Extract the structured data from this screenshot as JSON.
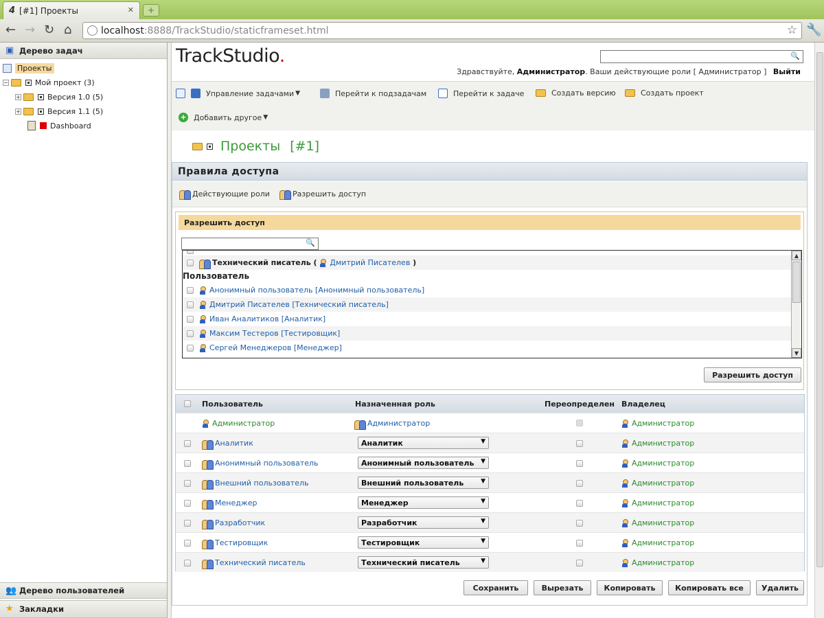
{
  "browser": {
    "tab_title": "[#1] Проекты",
    "url_host": "localhost",
    "url_rest": ":8888/TrackStudio/staticframeset.html"
  },
  "left": {
    "tasks_header": "Дерево задач",
    "tree": [
      {
        "label": "Проекты"
      },
      {
        "label": "Мой проект (3)"
      },
      {
        "label": "Версия 1.0 (5)"
      },
      {
        "label": "Версия 1.1 (5)"
      },
      {
        "label": "Dashboard"
      }
    ],
    "users_header": "Дерево пользователей",
    "bookmarks_header": "Закладки"
  },
  "header": {
    "logo": "TrackStudio",
    "logo_dot": ".",
    "greeting_pre": "Здравствуйте, ",
    "user": "Администратор",
    "greeting_mid": ". Ваши действующие роли  [ Администратор ]",
    "logout": "Выйти"
  },
  "toolbar": {
    "manage_tasks": "Управление задачами",
    "goto_subtasks": "Перейти к подзадачам",
    "goto_task": "Перейти к задаче",
    "create_version": "Создать версию",
    "create_project": "Создать проект",
    "add_other": "Добавить другое"
  },
  "page": {
    "title": "Проекты",
    "number": "[#1]"
  },
  "access": {
    "header": "Правила доступа",
    "effective_roles": "Действующие роли",
    "grant_access": "Разрешить доступ",
    "grant_panel_title": "Разрешить доступ",
    "list": {
      "tech_writer_prefix": "Технический писатель ( ",
      "tech_writer_user": "Дмитрий Писателев",
      "tech_writer_suffix": " )",
      "users_section": "Пользователь",
      "users": [
        "Анонимный пользователь [Анонимный пользователь]",
        "Дмитрий Писателев [Технический писатель]",
        "Иван Аналитиков [Аналитик]",
        "Максим Тестеров [Тестировщик]",
        "Сергей Менеджеров [Менеджер]"
      ]
    },
    "grant_button": "Разрешить доступ",
    "table": {
      "col_user": "Пользователь",
      "col_role": "Назначенная роль",
      "col_override": "Переопределен",
      "col_owner": "Владелец",
      "rows": [
        {
          "user": "Администратор",
          "role": "Администратор",
          "owner": "Администратор"
        },
        {
          "user": "Аналитик",
          "role": "Аналитик",
          "owner": "Администратор"
        },
        {
          "user": "Анонимный пользователь",
          "role": "Анонимный пользователь",
          "owner": "Администратор"
        },
        {
          "user": "Внешний пользователь",
          "role": "Внешний пользователь",
          "owner": "Администратор"
        },
        {
          "user": "Менеджер",
          "role": "Менеджер",
          "owner": "Администратор"
        },
        {
          "user": "Разработчик",
          "role": "Разработчик",
          "owner": "Администратор"
        },
        {
          "user": "Тестировщик",
          "role": "Тестировщик",
          "owner": "Администратор"
        },
        {
          "user": "Технический писатель",
          "role": "Технический писатель",
          "owner": "Администратор"
        }
      ]
    },
    "buttons": {
      "save": "Сохранить",
      "cut": "Вырезать",
      "copy": "Копировать",
      "copy_all": "Копировать все",
      "delete": "Удалить"
    }
  }
}
